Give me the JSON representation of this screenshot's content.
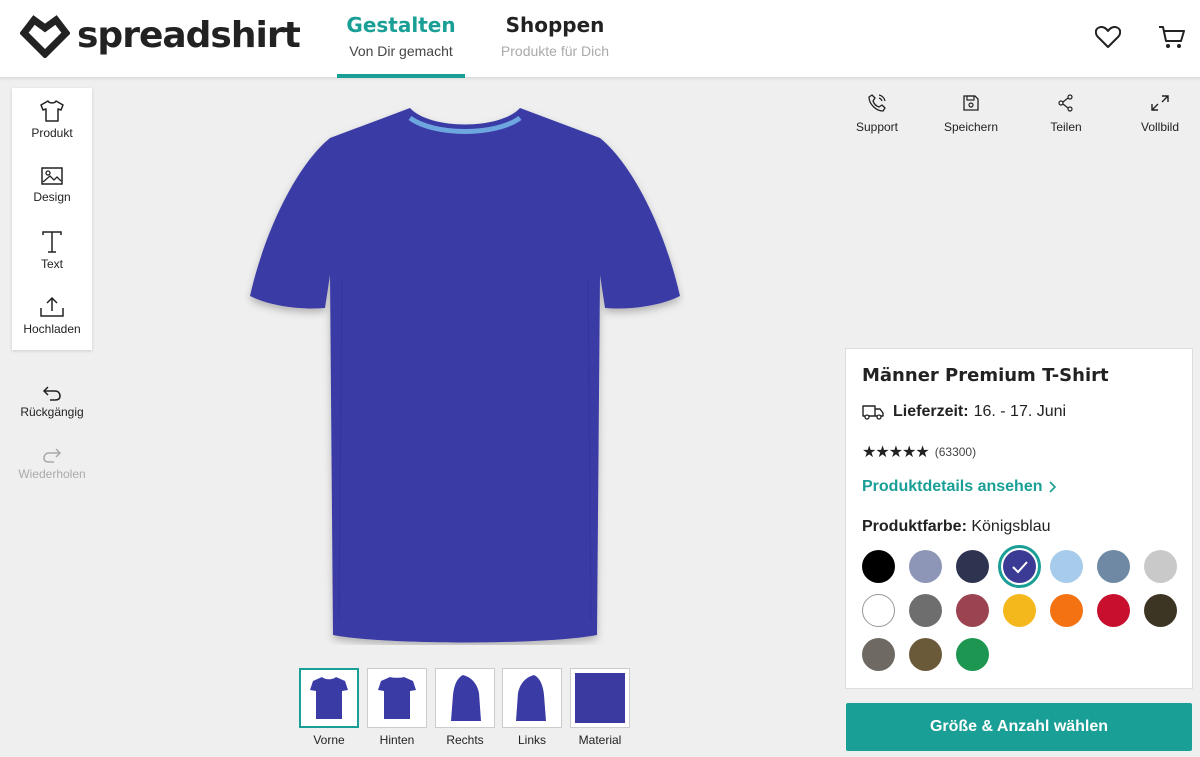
{
  "brand": {
    "name": "spreadshirt"
  },
  "nav": {
    "tabs": [
      {
        "title": "Gestalten",
        "subtitle": "Von Dir gemacht",
        "active": true
      },
      {
        "title": "Shoppen",
        "subtitle": "Produkte für Dich",
        "active": false
      }
    ],
    "icons": [
      "heart-icon",
      "cart-icon"
    ]
  },
  "tools": [
    {
      "label": "Produkt",
      "icon": "tshirt-icon"
    },
    {
      "label": "Design",
      "icon": "image-icon"
    },
    {
      "label": "Text",
      "icon": "text-icon"
    },
    {
      "label": "Hochladen",
      "icon": "upload-icon"
    }
  ],
  "history": {
    "undo_label": "Rückgängig",
    "redo_label": "Wiederholen"
  },
  "top_actions": [
    {
      "label": "Support",
      "icon": "phone-icon"
    },
    {
      "label": "Speichern",
      "icon": "save-icon"
    },
    {
      "label": "Teilen",
      "icon": "share-icon"
    },
    {
      "label": "Vollbild",
      "icon": "expand-icon"
    }
  ],
  "views": [
    {
      "label": "Vorne",
      "active": true
    },
    {
      "label": "Hinten",
      "active": false
    },
    {
      "label": "Rechts",
      "active": false
    },
    {
      "label": "Links",
      "active": false
    },
    {
      "label": "Material",
      "active": false
    }
  ],
  "product": {
    "title": "Männer Premium T-Shirt",
    "delivery_label": "Lieferzeit:",
    "delivery_value": "16. - 17. Juni",
    "stars": "★★★★★",
    "rating_count": "(63300)",
    "details_link": "Produktdetails ansehen",
    "color_label": "Produktfarbe:",
    "color_value": "Königsblau",
    "shirt_color": "#3b3ba6",
    "accent": "#1a9f96",
    "swatches": [
      {
        "color": "#000000",
        "selected": false
      },
      {
        "color": "#8e96b8",
        "selected": false
      },
      {
        "color": "#2e3450",
        "selected": false
      },
      {
        "color": "#3b3b95",
        "selected": true
      },
      {
        "color": "#a6cbeb",
        "selected": false
      },
      {
        "color": "#6f89a4",
        "selected": false
      },
      {
        "color": "#c9c9c9",
        "selected": false
      },
      {
        "color": "#ffffff",
        "selected": false
      },
      {
        "color": "#6e6e6e",
        "selected": false
      },
      {
        "color": "#9b4350",
        "selected": false
      },
      {
        "color": "#f5b81c",
        "selected": false
      },
      {
        "color": "#f57213",
        "selected": false
      },
      {
        "color": "#c8102e",
        "selected": false
      },
      {
        "color": "#3d3524",
        "selected": false
      },
      {
        "color": "#6e6a63",
        "selected": false
      },
      {
        "color": "#6b5a3a",
        "selected": false
      },
      {
        "color": "#1c9651",
        "selected": false
      }
    ]
  },
  "cta": {
    "label": "Größe & Anzahl wählen"
  }
}
